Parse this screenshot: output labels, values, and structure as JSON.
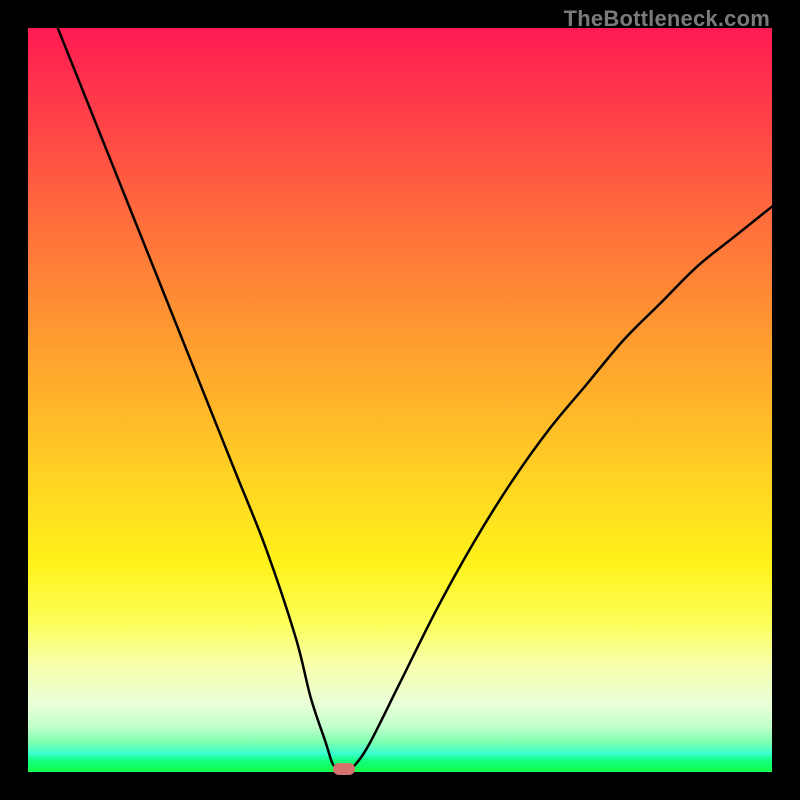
{
  "watermark": "TheBottleneck.com",
  "chart_data": {
    "type": "line",
    "title": "",
    "xlabel": "",
    "ylabel": "",
    "xlim": [
      0,
      100
    ],
    "ylim": [
      0,
      100
    ],
    "grid": false,
    "series": [
      {
        "name": "bottleneck-curve",
        "x": [
          4,
          8,
          12,
          16,
          20,
          24,
          28,
          32,
          36,
          38,
          40,
          41,
          42,
          43,
          44,
          46,
          50,
          55,
          60,
          65,
          70,
          75,
          80,
          85,
          90,
          95,
          100
        ],
        "y": [
          100,
          90,
          80,
          70,
          60,
          50,
          40,
          30,
          18,
          10,
          4,
          1,
          0.5,
          0.5,
          1,
          4,
          12,
          22,
          31,
          39,
          46,
          52,
          58,
          63,
          68,
          72,
          76
        ]
      }
    ],
    "annotations": [
      {
        "name": "minimum-marker",
        "x": 42.5,
        "y": 0.4,
        "color": "#d6736f"
      }
    ],
    "background_gradient": {
      "top": "#ff1a52",
      "bottom": "#10ff48",
      "meaning": "red=high bottleneck, green=low bottleneck"
    }
  }
}
